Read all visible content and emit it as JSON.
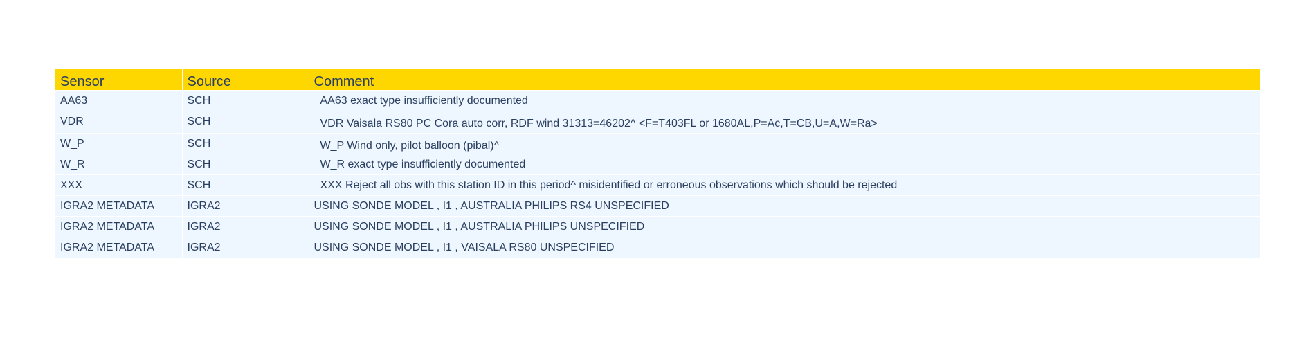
{
  "table": {
    "headers": {
      "sensor": "Sensor",
      "source": "Source",
      "comment": "Comment"
    },
    "rows": [
      {
        "sensor": "AA63",
        "source": "SCH",
        "comment": "AA63 exact type insufficiently documented"
      },
      {
        "sensor": "VDR",
        "source": "SCH",
        "comment": "VDR Vaisala RS80 PC Cora auto corr, RDF wind 31313=46202^ <F=T403FL or 1680AL,P=Ac,T=CB,U=A,W=Ra>"
      },
      {
        "sensor": "W_P",
        "source": "SCH",
        "comment": "W_P Wind only, pilot balloon (pibal)^"
      },
      {
        "sensor": "W_R",
        "source": "SCH",
        "comment": "W_R exact type insufficiently documented"
      },
      {
        "sensor": "XXX",
        "source": "SCH",
        "comment": "XXX Reject all obs with this station ID in this period^ misidentified or erroneous observations which should be rejected"
      },
      {
        "sensor": "IGRA2 METADATA",
        "source": "IGRA2",
        "comment": "USING SONDE MODEL , I1 , AUSTRALIA PHILIPS RS4 UNSPECIFIED"
      },
      {
        "sensor": "IGRA2 METADATA",
        "source": "IGRA2",
        "comment": "USING SONDE MODEL , I1 , AUSTRALIA PHILIPS UNSPECIFIED"
      },
      {
        "sensor": "IGRA2 METADATA",
        "source": "IGRA2",
        "comment": "USING SONDE MODEL , I1 , VAISALA RS80 UNSPECIFIED"
      }
    ]
  },
  "colors": {
    "header_bg": "#ffd700",
    "cell_bg": "#eef6ff",
    "text": "#2a3f5f"
  }
}
